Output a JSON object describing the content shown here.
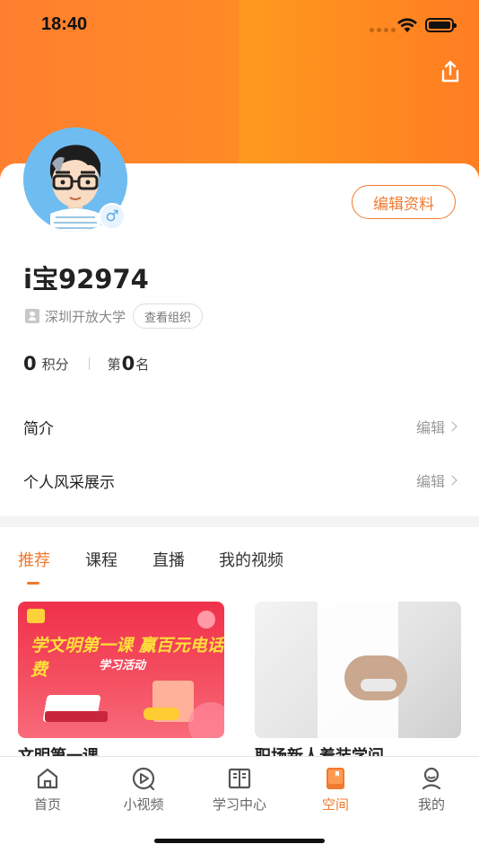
{
  "status_bar": {
    "time": "18:40"
  },
  "profile": {
    "username": "i宝92974",
    "organization": "深圳开放大学",
    "view_org_label": "查看组织",
    "edit_profile_label": "编辑资料",
    "gender_symbol": "♂",
    "points_value": "0",
    "points_label": "积分",
    "rank_prefix": "第",
    "rank_value": "0",
    "rank_suffix": "名"
  },
  "info_rows": [
    {
      "title": "简介",
      "action": "编辑"
    },
    {
      "title": "个人风采展示",
      "action": "编辑"
    }
  ],
  "tabs": [
    "推荐",
    "课程",
    "直播",
    "我的视频"
  ],
  "active_tab": 0,
  "videos": [
    {
      "title": "文明第一课",
      "banner_title": "学文明第一课 赢百元电话费",
      "banner_sub": "学习活动"
    },
    {
      "title": "职场新人着装学问"
    }
  ],
  "bottom_nav": [
    {
      "label": "首页",
      "icon": "home-icon"
    },
    {
      "label": "小视频",
      "icon": "short-video-icon"
    },
    {
      "label": "学习中心",
      "icon": "book-icon"
    },
    {
      "label": "空间",
      "icon": "space-icon"
    },
    {
      "label": "我的",
      "icon": "user-icon"
    }
  ],
  "active_nav": 3,
  "colors": {
    "accent": "#f07a2e",
    "header": "#ff8a26"
  }
}
